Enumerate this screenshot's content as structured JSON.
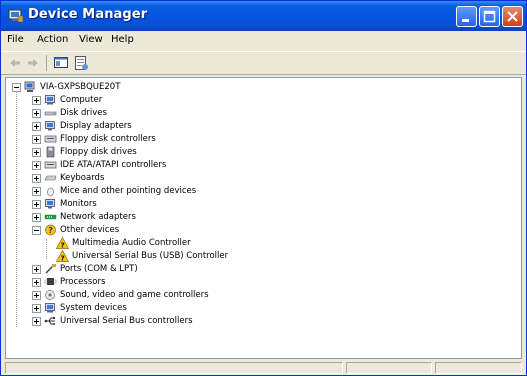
{
  "window": {
    "title": "Device Manager"
  },
  "menubar": {
    "items": [
      "File",
      "Action",
      "View",
      "Help"
    ]
  },
  "tree": {
    "root": "VIA-GXPSBQUE20T",
    "categories": [
      {
        "label": "Computer",
        "icon": "computer-icon",
        "expanded": false
      },
      {
        "label": "Disk drives",
        "icon": "disk-drive-icon",
        "expanded": false
      },
      {
        "label": "Display adapters",
        "icon": "display-adapter-icon",
        "expanded": false
      },
      {
        "label": "Floppy disk controllers",
        "icon": "floppy-controller-icon",
        "expanded": false
      },
      {
        "label": "Floppy disk drives",
        "icon": "floppy-drive-icon",
        "expanded": false
      },
      {
        "label": "IDE ATA/ATAPI controllers",
        "icon": "ide-controller-icon",
        "expanded": false
      },
      {
        "label": "Keyboards",
        "icon": "keyboard-icon",
        "expanded": false
      },
      {
        "label": "Mice and other pointing devices",
        "icon": "mouse-icon",
        "expanded": false
      },
      {
        "label": "Monitors",
        "icon": "monitor-icon",
        "expanded": false
      },
      {
        "label": "Network adapters",
        "icon": "network-adapter-icon",
        "expanded": false
      },
      {
        "label": "Other devices",
        "icon": "other-devices-icon",
        "expanded": true,
        "children": [
          {
            "label": "Multimedia Audio Controller",
            "icon": "unknown-device-warning-icon"
          },
          {
            "label": "Universal Serial Bus (USB) Controller",
            "icon": "unknown-device-warning-icon"
          }
        ]
      },
      {
        "label": "Ports (COM & LPT)",
        "icon": "port-icon",
        "expanded": false
      },
      {
        "label": "Processors",
        "icon": "processor-icon",
        "expanded": false
      },
      {
        "label": "Sound, video and game controllers",
        "icon": "sound-icon",
        "expanded": false
      },
      {
        "label": "System devices",
        "icon": "system-devices-icon",
        "expanded": false
      },
      {
        "label": "Universal Serial Bus controllers",
        "icon": "usb-icon",
        "expanded": false
      }
    ]
  },
  "colors": {
    "titlebar": "#0554e3",
    "window_bg": "#ece9d8",
    "warning": "#f5c518"
  }
}
